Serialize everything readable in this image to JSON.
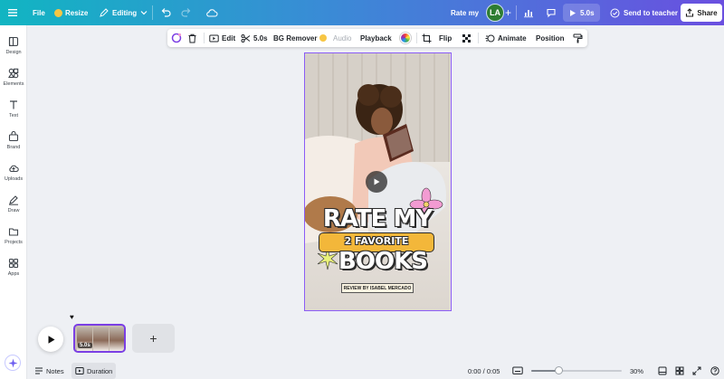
{
  "topbar": {
    "file_label": "File",
    "resize_label": "Resize",
    "editing_label": "Editing",
    "title": "Rate my",
    "avatar_initials": "LA",
    "duration_label": "5.0s",
    "send_label": "Send to teacher",
    "share_label": "Share",
    "gradient_start": "#11b5c2",
    "gradient_end": "#6a4fe0"
  },
  "sidebar": {
    "items": [
      {
        "label": "Design",
        "icon": "design-icon"
      },
      {
        "label": "Elements",
        "icon": "elements-icon"
      },
      {
        "label": "Text",
        "icon": "text-icon"
      },
      {
        "label": "Brand",
        "icon": "brand-icon"
      },
      {
        "label": "Uploads",
        "icon": "uploads-icon"
      },
      {
        "label": "Draw",
        "icon": "draw-icon"
      },
      {
        "label": "Projects",
        "icon": "projects-icon"
      },
      {
        "label": "Apps",
        "icon": "apps-icon"
      }
    ]
  },
  "context_toolbar": {
    "edit_label": "Edit",
    "trim_label": "5.0s",
    "bg_remover_label": "BG Remover",
    "audio_label": "Audio",
    "playback_label": "Playback",
    "flip_label": "Flip",
    "animate_label": "Animate",
    "position_label": "Position"
  },
  "canvas": {
    "title_line1": "RATE MY",
    "title_line2": "2 FAVORITE",
    "title_line3": "BOOKS",
    "review_tag": "REVIEW BY ISABEL MERCADO",
    "selection_color": "#8b5cf6",
    "accent_yellow": "#f3b73a",
    "accent_pink": "#f29bd2"
  },
  "timeline": {
    "clip_duration": "5.0s",
    "add_label": "+"
  },
  "bottombar": {
    "notes_label": "Notes",
    "duration_label": "Duration",
    "time_readout": "0:00 / 0:05",
    "zoom_label": "30%",
    "zoom_fraction": 0.3
  }
}
